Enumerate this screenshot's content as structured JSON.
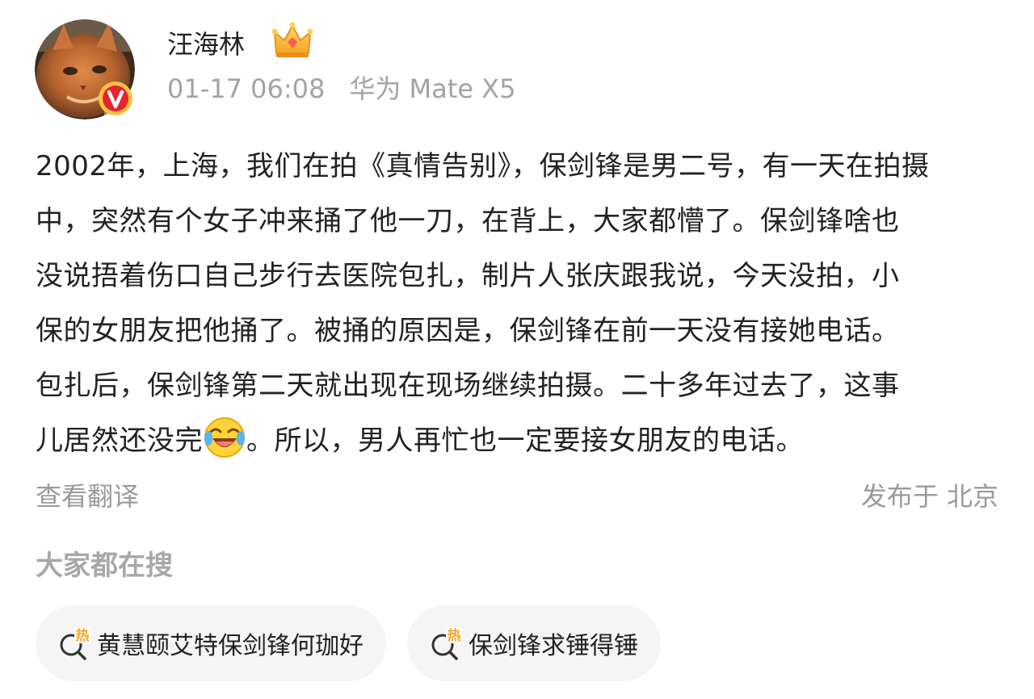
{
  "author": {
    "name": "汪海林",
    "avatar": "cat-avatar",
    "verified_badge": "v-icon",
    "member_badge": "crown-icon"
  },
  "meta": {
    "time": "01-17 06:08",
    "device": "华为 Mate X5"
  },
  "post": {
    "lines": [
      "2002年，上海，我们在拍《真情告别》，保剑锋是男二号，有一天在拍摄",
      "中，突然有个女子冲来捅了他一刀，在背上，大家都懵了。保剑锋啥也",
      "没说捂着伤口自己步行去医院包扎，制片人张庆跟我说，今天没拍，小",
      "保的女朋友把他捅了。被捅的原因是，保剑锋在前一天没有接她电话。",
      "包扎后，保剑锋第二天就出现在现场继续拍摄。二十多年过去了，这事"
    ],
    "last_line_before_emoji": "儿居然还没完",
    "emoji": "laugh-cry-emoji",
    "last_line_after_emoji": "。所以，男人再忙也一定要接女朋友的电话。"
  },
  "footer": {
    "translate": "查看翻译",
    "location": "发布于 北京"
  },
  "trending": {
    "title": "大家都在搜",
    "hot_icon": "hot-search-icon",
    "items": [
      {
        "label": "黄慧颐艾特保剑锋何珈好"
      },
      {
        "label": "保剑锋求锤得锤"
      }
    ]
  },
  "colors": {
    "text": "#222222",
    "muted": "#a3a3a3",
    "chip_bg": "#f5f5f5",
    "hot_orange": "#f5a623",
    "verified_red": "#e8222f",
    "verified_ring": "#f6c343"
  }
}
